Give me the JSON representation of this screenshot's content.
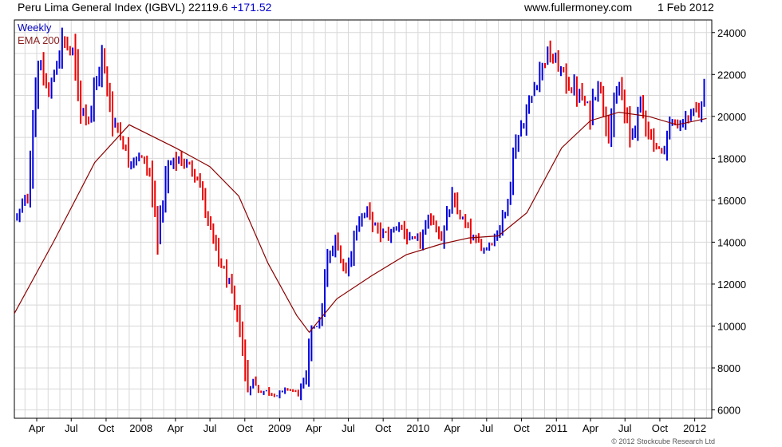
{
  "header": {
    "title": "Peru Lima General Index (IGBVL)",
    "last_value": "22119.6",
    "change": "+171.52",
    "website": "www.fullermoney.com",
    "date": "1 Feb 2012"
  },
  "legend": {
    "weekly": "Weekly",
    "ema": "EMA 200"
  },
  "copyright": "© 2012 Stockcube Research Ltd",
  "colors": {
    "up": "#0000dd",
    "down": "#ee0000",
    "ema": "#8b0000",
    "grid": "#d8d8d8",
    "frame": "#000000"
  },
  "chart_data": {
    "type": "line",
    "ylim": [
      5600,
      24600
    ],
    "yticks": [
      6000,
      8000,
      10000,
      12000,
      14000,
      16000,
      18000,
      20000,
      22000,
      24000
    ],
    "x_tick_labels": [
      "Apr",
      "Jul",
      "Oct",
      "2008",
      "Apr",
      "Jul",
      "Oct",
      "2009",
      "Apr",
      "Jul",
      "Oct",
      "2010",
      "Apr",
      "Jul",
      "Oct",
      "2011",
      "Apr",
      "Jul",
      "Oct",
      "2012"
    ],
    "x_range": [
      "2007-02-01",
      "2012-02-15"
    ],
    "grid": true,
    "legend_position": "top-left",
    "series": [
      {
        "name": "Weekly",
        "dates": [
          "2007-02-08",
          "2007-03-08",
          "2007-04-05",
          "2007-05-03",
          "2007-06-07",
          "2007-07-05",
          "2007-07-26",
          "2007-08-16",
          "2007-09-20",
          "2007-10-18",
          "2007-11-01",
          "2007-11-29",
          "2007-12-27",
          "2008-01-24",
          "2008-02-14",
          "2008-03-13",
          "2008-04-10",
          "2008-05-01",
          "2008-05-29",
          "2008-06-26",
          "2008-07-24",
          "2008-08-21",
          "2008-09-18",
          "2008-10-09",
          "2008-10-23",
          "2008-11-06",
          "2008-11-27",
          "2008-12-25",
          "2009-01-22",
          "2009-02-19",
          "2009-03-12",
          "2009-03-26",
          "2009-04-16",
          "2009-05-07",
          "2009-05-28",
          "2009-06-25",
          "2009-07-23",
          "2009-08-20",
          "2009-09-17",
          "2009-10-15",
          "2009-11-12",
          "2009-12-10",
          "2010-01-07",
          "2010-02-04",
          "2010-03-04",
          "2010-04-01",
          "2010-04-29",
          "2010-05-27",
          "2010-06-24",
          "2010-07-22",
          "2010-08-19",
          "2010-09-16",
          "2010-10-14",
          "2010-11-11",
          "2010-12-09",
          "2011-01-06",
          "2011-02-03",
          "2011-03-03",
          "2011-03-31",
          "2011-04-21",
          "2011-05-19",
          "2011-06-16",
          "2011-07-14",
          "2011-08-11",
          "2011-09-08",
          "2011-10-06",
          "2011-10-27",
          "2011-11-24",
          "2011-12-22",
          "2012-01-19",
          "2012-02-01"
        ],
        "values": [
          15200,
          16200,
          22500,
          21000,
          23600,
          23000,
          20500,
          20000,
          22800,
          19800,
          19500,
          17900,
          18200,
          17200,
          14400,
          17600,
          18000,
          17700,
          17200,
          15000,
          13200,
          12000,
          9800,
          6900,
          7400,
          6900,
          6900,
          6700,
          7000,
          6800,
          7600,
          10000,
          10100,
          13000,
          14000,
          12500,
          14800,
          15500,
          14500,
          14300,
          14900,
          14000,
          14100,
          15200,
          14200,
          16000,
          15000,
          14100,
          13700,
          14200,
          15400,
          18800,
          20100,
          21800,
          23000,
          22400,
          21500,
          21000,
          20200,
          21700,
          19300,
          21400,
          19000,
          20500,
          19000,
          18200,
          19600,
          19700,
          20000,
          20500,
          22100
        ]
      },
      {
        "name": "EMA 200",
        "dates": [
          "2007-02-01",
          "2007-05-15",
          "2007-09-01",
          "2007-12-01",
          "2008-04-01",
          "2008-07-01",
          "2008-09-15",
          "2008-12-01",
          "2009-02-15",
          "2009-03-20",
          "2009-06-01",
          "2009-09-01",
          "2009-12-01",
          "2010-03-01",
          "2010-05-15",
          "2010-08-01",
          "2010-10-15",
          "2011-01-15",
          "2011-04-01",
          "2011-06-15",
          "2011-09-01",
          "2011-11-15",
          "2012-02-01"
        ],
        "values": [
          10600,
          14000,
          17800,
          19600,
          18500,
          17600,
          16200,
          13000,
          10500,
          9700,
          11300,
          12400,
          13400,
          13900,
          14200,
          14300,
          15400,
          18500,
          19800,
          20200,
          20000,
          19600,
          19900
        ]
      }
    ]
  }
}
